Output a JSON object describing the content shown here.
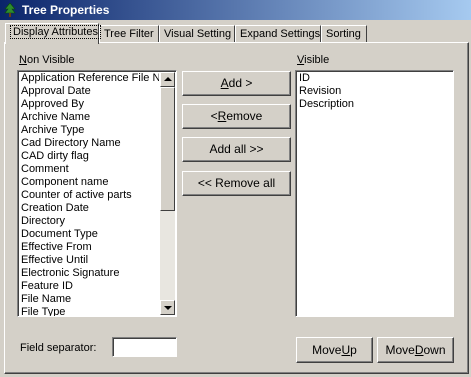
{
  "window": {
    "title": "Tree Properties"
  },
  "tabs": [
    {
      "label": "Display Attributes",
      "active": true
    },
    {
      "label": "Tree Filter"
    },
    {
      "label": "Visual Setting"
    },
    {
      "label": "Expand Settings"
    },
    {
      "label": "Sorting"
    }
  ],
  "non_visible": {
    "label_mnemonic": "N",
    "label_rest": "on Visible",
    "items": [
      "Application Reference File Na",
      "Approval Date",
      "Approved By",
      "Archive Name",
      "Archive Type",
      "Cad Directory Name",
      "CAD dirty flag",
      "Comment",
      "Component name",
      "Counter of active parts",
      "Creation Date",
      "Directory",
      "Document Type",
      "Effective From",
      "Effective Until",
      "Electronic Signature",
      "Feature ID",
      "File Name",
      "File Type"
    ]
  },
  "visible": {
    "label_mnemonic": "V",
    "label_rest": "isible",
    "items": [
      "ID",
      "Revision",
      "Description"
    ]
  },
  "buttons": {
    "add": {
      "pre": "",
      "mn": "A",
      "post": "dd >"
    },
    "remove": {
      "pre": "< ",
      "mn": "R",
      "post": "emove"
    },
    "add_all": {
      "pre": "Add all >>",
      "mn": "",
      "post": ""
    },
    "remove_all": {
      "pre": "<< Remove all",
      "mn": "",
      "post": ""
    },
    "move_up": {
      "pre": "Move ",
      "mn": "U",
      "post": "p"
    },
    "move_down": {
      "pre": "Move ",
      "mn": "D",
      "post": "own"
    }
  },
  "field_separator": {
    "label": "Field separator:",
    "value": ""
  }
}
